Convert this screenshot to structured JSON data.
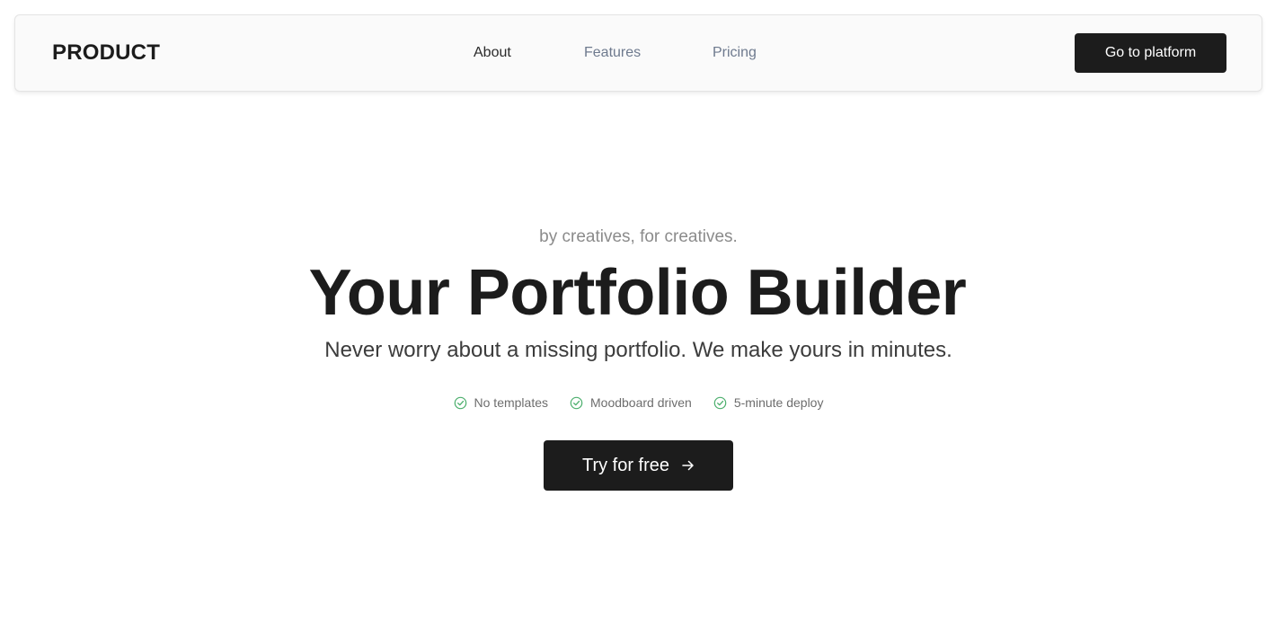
{
  "header": {
    "brand": "PRODUCT",
    "nav": [
      {
        "label": "About",
        "active": true
      },
      {
        "label": "Features",
        "active": false
      },
      {
        "label": "Pricing",
        "active": false
      }
    ],
    "platform_button_label": "Go to platform"
  },
  "hero": {
    "tagline": "by creatives, for creatives.",
    "headline": "Your Portfolio Builder",
    "subheadline": "Never worry about a missing portfolio. We make yours in minutes.",
    "features": [
      {
        "label": "No templates",
        "icon": "check-circle-icon"
      },
      {
        "label": "Moodboard driven",
        "icon": "check-circle-icon"
      },
      {
        "label": "5-minute deploy",
        "icon": "check-circle-icon"
      }
    ],
    "cta_label": "Try for free",
    "cta_icon": "arrow-right-icon"
  },
  "colors": {
    "background": "#ffffff",
    "navbar_background": "#fafafa",
    "primary": "#1c1c1c",
    "muted_link": "#6e7a8e",
    "check_green": "#4caf6d"
  }
}
